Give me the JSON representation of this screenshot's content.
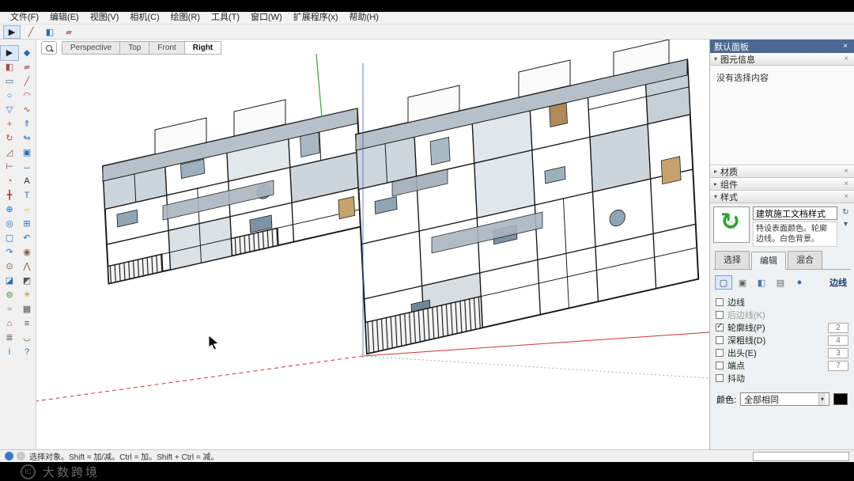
{
  "icons": {
    "close": "×",
    "chevron_expanded": "▾",
    "chevron_collapsed": "▸",
    "dropdown": "▾",
    "sync": "↻",
    "house": "⌂"
  },
  "menu_bar": {
    "items": [
      {
        "name": "menu-file",
        "label": "文件(F)"
      },
      {
        "name": "menu-edit",
        "label": "编辑(E)"
      },
      {
        "name": "menu-view",
        "label": "视图(V)"
      },
      {
        "name": "menu-camera",
        "label": "相机(C)"
      },
      {
        "name": "menu-draw",
        "label": "绘图(R)"
      },
      {
        "name": "menu-tools",
        "label": "工具(T)"
      },
      {
        "name": "menu-window",
        "label": "窗口(W)"
      },
      {
        "name": "menu-extensions",
        "label": "扩展程序(x)"
      },
      {
        "name": "menu-help",
        "label": "帮助(H)"
      }
    ]
  },
  "top_toolbar": {
    "tools": [
      {
        "name": "toolbar-select-icon",
        "glyph": "▶",
        "color": "#222222",
        "active": true
      },
      {
        "name": "toolbar-line-icon",
        "glyph": "╱",
        "color": "#a84c3f"
      },
      {
        "name": "toolbar-paint-bucket-icon",
        "glyph": "◧",
        "color": "#2f6db3"
      },
      {
        "name": "toolbar-eraser-icon",
        "glyph": "▰",
        "color": "#c77f9b"
      }
    ]
  },
  "left_toolbar": {
    "tools": [
      {
        "name": "tool-select",
        "glyph": "▶",
        "color": "#222222",
        "active": true
      },
      {
        "name": "tool-make-component",
        "glyph": "◆",
        "color": "#2f6db3"
      },
      {
        "name": "tool-paint-bucket",
        "glyph": "◧",
        "color": "#a84c3f"
      },
      {
        "name": "tool-eraser",
        "glyph": "▰",
        "color": "#c77f9b"
      },
      {
        "name": "tool-rectangle",
        "glyph": "▭",
        "color": "#2f6db3"
      },
      {
        "name": "tool-line",
        "glyph": "╱",
        "color": "#a84c3f"
      },
      {
        "name": "tool-circle",
        "glyph": "○",
        "color": "#2f6db3"
      },
      {
        "name": "tool-arc",
        "glyph": "◠",
        "color": "#a84c3f"
      },
      {
        "name": "tool-polygon",
        "glyph": "▽",
        "color": "#2f6db3"
      },
      {
        "name": "tool-freehand",
        "glyph": "∿",
        "color": "#a84c3f"
      },
      {
        "name": "tool-move",
        "glyph": "+",
        "color": "#a84c3f"
      },
      {
        "name": "tool-push-pull",
        "glyph": "⇑",
        "color": "#2f6db3"
      },
      {
        "name": "tool-rotate",
        "glyph": "↻",
        "color": "#a84c3f"
      },
      {
        "name": "tool-follow-me",
        "glyph": "↬",
        "color": "#2f6db3"
      },
      {
        "name": "tool-scale",
        "glyph": "◿",
        "color": "#a84c3f"
      },
      {
        "name": "tool-offset",
        "glyph": "▣",
        "color": "#2f6db3"
      },
      {
        "name": "tool-tape-measure",
        "glyph": "⊢",
        "color": "#a84c3f"
      },
      {
        "name": "tool-dimension",
        "glyph": "↔",
        "color": "#2f6db3"
      },
      {
        "name": "tool-protractor",
        "glyph": "◔",
        "color": "#a84c3f"
      },
      {
        "name": "tool-text",
        "glyph": "A",
        "color": "#222222"
      },
      {
        "name": "tool-axes",
        "glyph": "╋",
        "color": "#a84c3f"
      },
      {
        "name": "tool-3d-text",
        "glyph": "T",
        "color": "#2f6db3"
      },
      {
        "name": "tool-orbit",
        "glyph": "⊕",
        "color": "#2f6db3"
      },
      {
        "name": "tool-pan",
        "glyph": "⇔",
        "color": "#c2983a"
      },
      {
        "name": "tool-zoom",
        "glyph": "◎",
        "color": "#2f6db3"
      },
      {
        "name": "tool-zoom-window",
        "glyph": "⊞",
        "color": "#2f6db3"
      },
      {
        "name": "tool-zoom-extents",
        "glyph": "▢",
        "color": "#2f6db3"
      },
      {
        "name": "tool-previous",
        "glyph": "↶",
        "color": "#2f6db3"
      },
      {
        "name": "tool-next",
        "glyph": "↷",
        "color": "#2f6db3"
      },
      {
        "name": "tool-position-camera",
        "glyph": "◉",
        "color": "#8a5a3a"
      },
      {
        "name": "tool-look-around",
        "glyph": "⊙",
        "color": "#8a5a3a"
      },
      {
        "name": "tool-walk",
        "glyph": "⋀",
        "color": "#8a5a3a"
      },
      {
        "name": "tool-section-plane",
        "glyph": "◪",
        "color": "#2f6db3"
      },
      {
        "name": "tool-section-fill",
        "glyph": "◩",
        "color": "#555555"
      },
      {
        "name": "tool-add-location",
        "glyph": "⊚",
        "color": "#3a8a4d"
      },
      {
        "name": "tool-shadows",
        "glyph": "☀",
        "color": "#c2983a"
      },
      {
        "name": "tool-fog",
        "glyph": "≈",
        "color": "#7a8a99"
      },
      {
        "name": "tool-match-photo",
        "glyph": "▦",
        "color": "#555555"
      },
      {
        "name": "tool-3d-warehouse",
        "glyph": "⌂",
        "color": "#a84c3f"
      },
      {
        "name": "tool-layers",
        "glyph": "≡",
        "color": "#555555"
      },
      {
        "name": "tool-outliner",
        "glyph": "≣",
        "color": "#555555"
      },
      {
        "name": "tool-soften-edges",
        "glyph": "◡",
        "color": "#555555"
      },
      {
        "name": "tool-model-info",
        "glyph": "i",
        "color": "#2f6db3"
      },
      {
        "name": "tool-help",
        "glyph": "?",
        "color": "#2f6db3"
      }
    ]
  },
  "scene_tabs": {
    "tabs": [
      {
        "name": "scene-tab-perspective",
        "label": "Perspective"
      },
      {
        "name": "scene-tab-top",
        "label": "Top"
      },
      {
        "name": "scene-tab-front",
        "label": "Front"
      },
      {
        "name": "scene-tab-right",
        "label": "Right",
        "active": true
      }
    ]
  },
  "viewport": {
    "axis_colors": {
      "red": "#cc3333",
      "green": "#3aa03a",
      "blue": "#4253c4"
    }
  },
  "right_panel": {
    "title": "默认面板",
    "entity_info": {
      "title": "图元信息",
      "empty_message": "没有选择内容"
    },
    "materials": {
      "title": "材质"
    },
    "components": {
      "title": "组件"
    },
    "styles": {
      "title": "样式",
      "style_name": "建筑施工文档样式",
      "style_desc": "特设表面颜色。轮廓边线。白色背景。",
      "tabs": [
        {
          "name": "styles-tab-select",
          "label": "选择"
        },
        {
          "name": "styles-tab-edit",
          "label": "编辑",
          "active": true
        },
        {
          "name": "styles-tab-mix",
          "label": "混合"
        }
      ],
      "mini_icons": [
        {
          "name": "update-style-icon",
          "glyph": "↻"
        },
        {
          "name": "style-menu-icon",
          "glyph": "▾"
        }
      ],
      "edge_icons": [
        {
          "name": "edge-settings-icon",
          "glyph": "▢",
          "color": "#444444",
          "active": true
        },
        {
          "name": "face-settings-icon",
          "glyph": "▣",
          "color": "#666666"
        },
        {
          "name": "background-settings-icon",
          "glyph": "◧",
          "color": "#4a7ab5"
        },
        {
          "name": "watermark-settings-icon",
          "glyph": "▤",
          "color": "#666666"
        },
        {
          "name": "modeling-settings-icon",
          "glyph": "●",
          "color": "#2f6db3"
        }
      ],
      "category_label": "边线",
      "settings": [
        {
          "name": "setting-edges",
          "label": "边线",
          "checked": false,
          "value": ""
        },
        {
          "name": "setting-back-edges",
          "label": "后边线(K)",
          "checked": false,
          "value": "",
          "disabled": true
        },
        {
          "name": "setting-profiles",
          "label": "轮廓线(P)",
          "checked": true,
          "value": "2"
        },
        {
          "name": "setting-depth-cue",
          "label": "深粗线(D)",
          "checked": false,
          "value": "4"
        },
        {
          "name": "setting-extension",
          "label": "出头(E)",
          "checked": false,
          "value": "3"
        },
        {
          "name": "setting-endpoints",
          "label": "端点",
          "checked": false,
          "value": "7"
        },
        {
          "name": "setting-jitter",
          "label": "抖动",
          "checked": false,
          "value": ""
        }
      ],
      "color_label": "颜色:",
      "color_mode": "全部相同",
      "color_swatch": "#000000"
    }
  },
  "status_bar": {
    "icons": [
      {
        "name": "geolocation-icon",
        "color": "#3f77c2"
      },
      {
        "name": "credits-icon",
        "color": "#c9c9c9"
      }
    ],
    "hint": "选择对象。Shift = 加/减。Ctrl = 加。Shift + Ctrl = 减。",
    "measurement_value": ""
  },
  "watermark": {
    "logo": "IC",
    "text": "大数跨境"
  }
}
